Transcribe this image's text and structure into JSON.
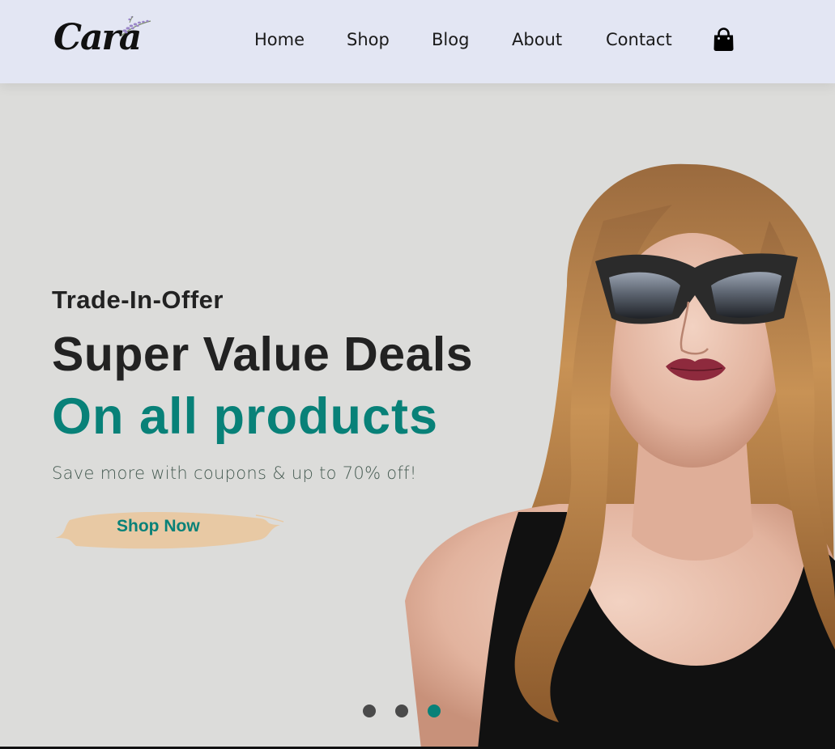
{
  "header": {
    "logo_text": "Cara",
    "nav": [
      {
        "label": "Home"
      },
      {
        "label": "Shop"
      },
      {
        "label": "Blog"
      },
      {
        "label": "About"
      },
      {
        "label": "Contact"
      }
    ],
    "cart_icon": "shopping-bag-icon"
  },
  "hero": {
    "eyebrow": "Trade-In-Offer",
    "headline": "Super Value Deals",
    "subheadline": "On all products",
    "tagline": "Save more with coupons & up to 70% off!",
    "button_label": "Shop Now",
    "image": "woman-sunglasses-photo",
    "carousel": {
      "count": 3,
      "active_index": 2
    }
  },
  "colors": {
    "header_bg": "#e3e6f3",
    "hero_bg": "#dcdcda",
    "accent": "#088178",
    "button_brush": "#e8c9a4",
    "dot_inactive": "#4a4a4a"
  }
}
